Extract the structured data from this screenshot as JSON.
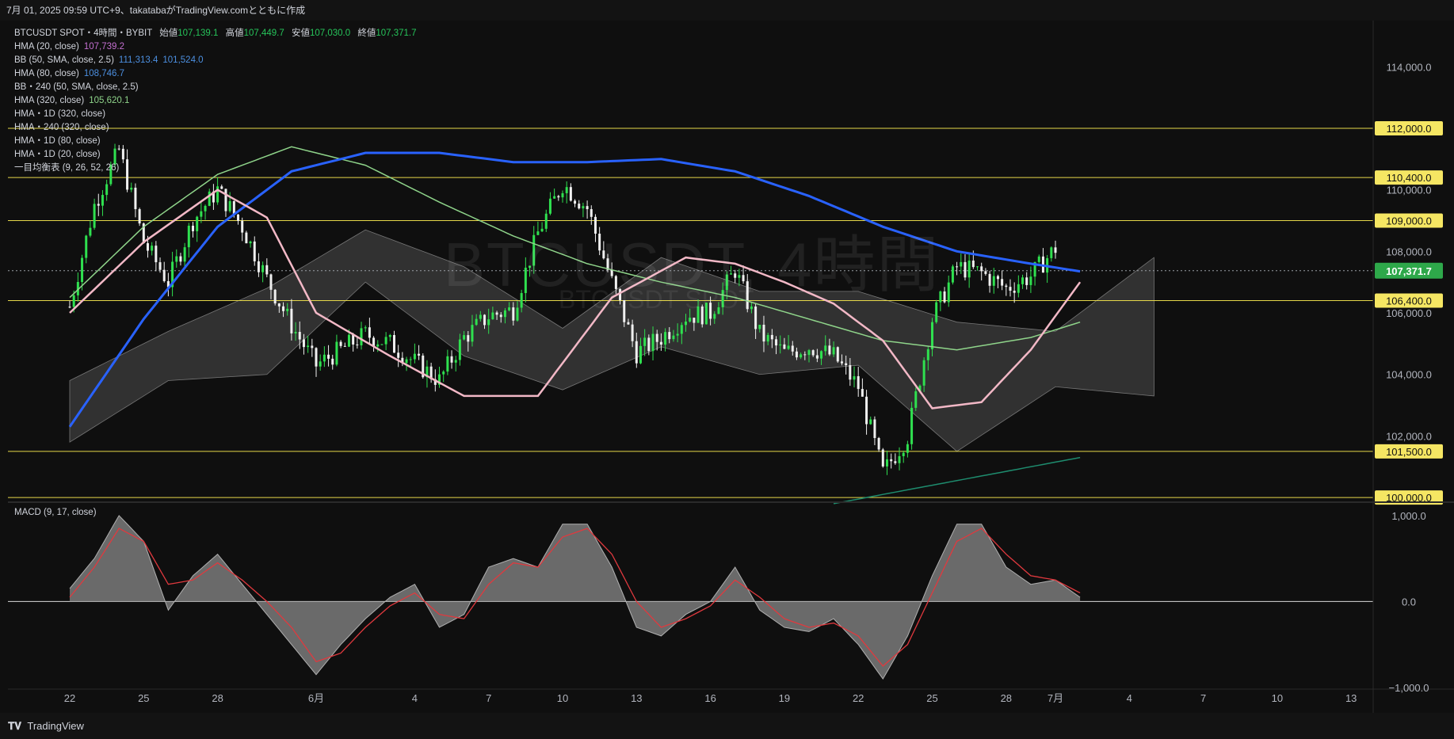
{
  "header": {
    "text": "7月 01, 2025 09:59 UTC+9、takatabaがTradingView.comとともに作成"
  },
  "watermark": {
    "title": "BTCUSDT, 4時間",
    "subtitle": "BTCUSDT SPOT"
  },
  "legend": {
    "symbol_line": {
      "name": "BTCUSDT SPOT・4時間・BYBIT",
      "open_label": "始値",
      "open": "107,139.1",
      "high_label": "高値",
      "high": "107,449.7",
      "low_label": "安値",
      "low": "107,030.0",
      "close_label": "終値",
      "close": "107,371.7"
    },
    "indicators": [
      {
        "name": "HMA (20, close)",
        "values": [
          "107,739.2"
        ],
        "color": "#c36fd0"
      },
      {
        "name": "BB (50, SMA, close, 2.5)",
        "values": [
          "111,313.4",
          "101,524.0"
        ],
        "color": "#4c8fe0"
      },
      {
        "name": "HMA (80, close)",
        "values": [
          "108,746.7"
        ],
        "color": "#4c8fe0"
      },
      {
        "name": "BB・240 (50, SMA, close, 2.5)",
        "values": [],
        "color": "#4c8fe0"
      },
      {
        "name": "HMA (320, close)",
        "values": [
          "105,620.1"
        ],
        "color": "#8fd48a"
      },
      {
        "name": "HMA・1D (320, close)",
        "values": [],
        "color": "#1e8c6e"
      },
      {
        "name": "HMA・240 (320, close)",
        "values": [],
        "color": "#2962ff"
      },
      {
        "name": "HMA・1D (80, close)",
        "values": [],
        "color": "#f2b8c6"
      },
      {
        "name": "HMA・1D (20, close)",
        "values": [],
        "color": "#f2b8c6"
      },
      {
        "name": "一目均衡表 (9, 26, 52, 26)",
        "values": [],
        "color": "#888888"
      }
    ]
  },
  "macd_label": "MACD (9, 17, close)",
  "footer": {
    "brand": "TradingView"
  },
  "chart_data": [
    {
      "type": "candlestick",
      "title": "BTCUSDT, 4時間",
      "xlabel": "",
      "ylabel": "",
      "ylim": [
        99900,
        115500
      ],
      "grid": false,
      "x_ticks": [
        "22",
        "25",
        "28",
        "6月",
        "4",
        "7",
        "10",
        "13",
        "16",
        "19",
        "22",
        "25",
        "28",
        "7月",
        "4",
        "7",
        "10",
        "13"
      ],
      "x_tick_day_index": [
        0,
        3,
        6,
        10,
        14,
        17,
        20,
        23,
        26,
        29,
        32,
        35,
        38,
        40,
        43,
        46,
        49,
        52
      ],
      "y_ticks": [
        102000,
        104000,
        106000,
        108000,
        110000,
        114000
      ],
      "y_tick_labels": [
        "102,000.0",
        "104,000.0",
        "106,000.0",
        "108,000.0",
        "110,000.0",
        "114,000.0"
      ],
      "horizontal_levels": [
        {
          "value": 112000,
          "label": "112,000.0"
        },
        {
          "value": 110400,
          "label": "110,400.0"
        },
        {
          "value": 109000,
          "label": "109,000.0"
        },
        {
          "value": 106400,
          "label": "106,400.0"
        },
        {
          "value": 101500,
          "label": "101,500.0"
        },
        {
          "value": 100000,
          "label": "100,000.0"
        }
      ],
      "last_price": {
        "value": 107371.7,
        "label": "107,371.7"
      },
      "close_path_days": [
        0,
        1,
        2,
        3,
        4,
        5,
        6,
        7,
        8,
        9,
        10,
        11,
        12,
        13,
        14,
        15,
        16,
        17,
        18,
        19,
        20,
        21,
        22,
        23,
        24,
        25,
        26,
        27,
        28,
        29,
        30,
        31,
        32,
        33,
        34,
        35,
        36,
        37,
        38,
        39,
        40
      ],
      "close_path": [
        106200,
        109500,
        111300,
        108300,
        107000,
        109000,
        110000,
        108800,
        107100,
        105600,
        104300,
        104800,
        105300,
        105000,
        104400,
        103800,
        105200,
        105900,
        106100,
        108600,
        110200,
        109400,
        107000,
        104700,
        105200,
        105900,
        106000,
        107400,
        105300,
        104700,
        104900,
        104600,
        103600,
        100800,
        102000,
        105800,
        107500,
        107300,
        106800,
        107200,
        108100
      ],
      "series": [
        {
          "name": "HMA (320, close)",
          "color": "#8fd48a",
          "days": [
            0,
            3,
            6,
            9,
            12,
            15,
            18,
            21,
            24,
            27,
            30,
            33,
            36,
            39,
            41
          ],
          "values": [
            106500,
            108800,
            110500,
            111400,
            110800,
            109600,
            108500,
            107600,
            107000,
            106500,
            105800,
            105100,
            104800,
            105200,
            105700
          ]
        },
        {
          "name": "HMA・240 (320, close)",
          "color": "#2962ff",
          "days": [
            0,
            3,
            6,
            9,
            12,
            15,
            18,
            21,
            24,
            27,
            30,
            33,
            36,
            39,
            41
          ],
          "values": [
            102300,
            105800,
            108800,
            110600,
            111200,
            111200,
            110900,
            110900,
            111000,
            110600,
            109800,
            108800,
            108000,
            107600,
            107350
          ]
        },
        {
          "name": "HMA・1D (80, close)",
          "color": "#f2b8c6",
          "days": [
            0,
            3,
            6,
            8,
            10,
            13,
            16,
            19,
            22,
            25,
            27,
            29,
            31,
            33,
            35,
            37,
            39,
            41
          ],
          "values": [
            106000,
            108300,
            110000,
            109100,
            106000,
            104600,
            103300,
            103300,
            106500,
            107800,
            107600,
            107000,
            106300,
            105100,
            102900,
            103100,
            104800,
            107000
          ]
        },
        {
          "name": "HMA・1D (320, close)",
          "color": "#1e8c6e",
          "days": [
            31,
            35,
            41
          ],
          "values": [
            99800,
            100400,
            101300
          ]
        }
      ],
      "ichimoku_cloud": {
        "color": "#5a5a5a",
        "days": [
          0,
          4,
          8,
          12,
          16,
          20,
          24,
          28,
          32,
          36,
          40,
          44
        ],
        "upper": [
          103800,
          105400,
          106800,
          108700,
          107500,
          105500,
          107800,
          106700,
          106700,
          105700,
          105400,
          107800
        ],
        "lower": [
          101800,
          103800,
          104000,
          107000,
          104600,
          103500,
          104900,
          104000,
          104300,
          101500,
          103600,
          103300
        ]
      }
    },
    {
      "type": "area",
      "title": "MACD (9, 17, close)",
      "ylim": [
        -1000,
        1100
      ],
      "y_ticks": [
        1000,
        0,
        -1000
      ],
      "y_tick_labels": [
        "1,000.0",
        "0.0",
        "−1,000.0"
      ],
      "days": [
        0,
        1,
        2,
        3,
        4,
        5,
        6,
        7,
        8,
        9,
        10,
        11,
        12,
        13,
        14,
        15,
        16,
        17,
        18,
        19,
        20,
        21,
        22,
        23,
        24,
        25,
        26,
        27,
        28,
        29,
        30,
        31,
        32,
        33,
        34,
        35,
        36,
        37,
        38,
        39,
        40,
        41
      ],
      "macd": [
        150,
        500,
        1000,
        700,
        -100,
        300,
        550,
        200,
        -150,
        -500,
        -850,
        -500,
        -200,
        50,
        200,
        -300,
        -150,
        400,
        500,
        400,
        900,
        900,
        400,
        -300,
        -400,
        -150,
        0,
        400,
        -100,
        -300,
        -350,
        -200,
        -500,
        -900,
        -400,
        300,
        900,
        900,
        400,
        200,
        250,
        50
      ],
      "signal": [
        50,
        400,
        850,
        700,
        200,
        250,
        450,
        250,
        0,
        -300,
        -700,
        -600,
        -300,
        -50,
        100,
        -150,
        -200,
        200,
        450,
        400,
        750,
        850,
        550,
        0,
        -300,
        -200,
        -50,
        250,
        50,
        -200,
        -300,
        -250,
        -400,
        -750,
        -500,
        100,
        700,
        850,
        550,
        300,
        250,
        100
      ]
    }
  ]
}
